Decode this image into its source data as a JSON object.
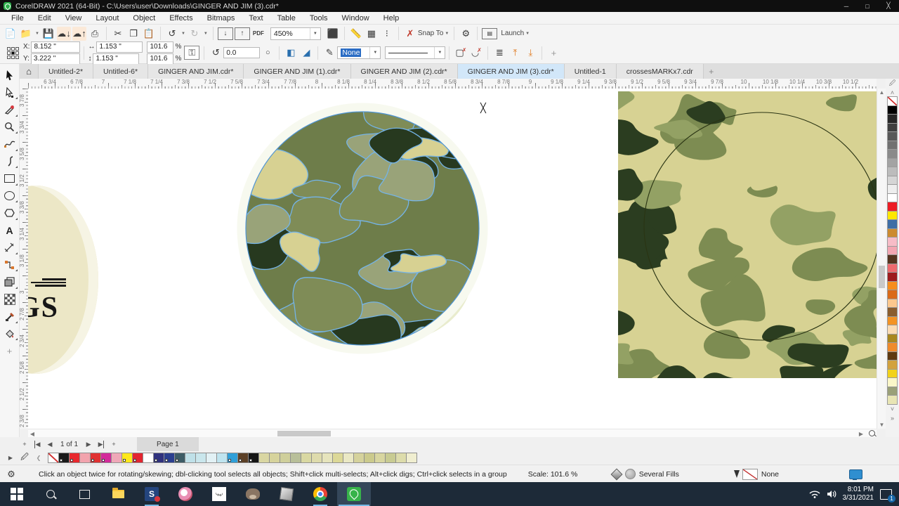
{
  "window": {
    "title": "CorelDRAW 2021 (64-Bit) - C:\\Users\\user\\Downloads\\GINGER AND JIM (3).cdr*"
  },
  "menu_bar": {
    "items": [
      "File",
      "Edit",
      "View",
      "Layout",
      "Object",
      "Effects",
      "Bitmaps",
      "Text",
      "Table",
      "Tools",
      "Window",
      "Help"
    ]
  },
  "toolbar": {
    "zoom_level": "450%",
    "pdf_label": "PDF",
    "snap_to_label": "Snap To",
    "launch_label": "Launch"
  },
  "property_bar": {
    "x_label": "X:",
    "y_label": "Y:",
    "x_value": "8.152 \"",
    "y_value": "3.222 \"",
    "width_value": "1.153 \"",
    "height_value": "1.153 \"",
    "scale_h": "101.6",
    "scale_v": "101.6",
    "percent": "%",
    "rotation_value": "0.0",
    "outline_width_value": "None"
  },
  "document_tabs": {
    "active_index": 5,
    "tabs": [
      "Untitled-2*",
      "Untitled-6*",
      "GINGER AND JIM.cdr*",
      "GINGER AND JIM (1).cdr*",
      "GINGER AND JIM (2).cdr*",
      "GINGER AND JIM (3).cdr*",
      "Untitled-1",
      "crossesMARKx7.cdr"
    ]
  },
  "rulers": {
    "horizontal_labels": [
      "6 3/4",
      "6 7/8",
      "7",
      "7 1/8",
      "7 1/4",
      "7 3/8",
      "7 1/2",
      "7 5/8",
      "7 3/4",
      "7 7/8",
      "8",
      "8 1/8",
      "8 1/4",
      "8 3/8",
      "8 1/2",
      "8 5/8",
      "8 3/4",
      "8 7/8",
      "9",
      "9 1/8",
      "9 1/4",
      "9 3/8",
      "9 1/2",
      "9 5/8",
      "9 3/4",
      "9 7/8",
      "10",
      "10 1/8",
      "10 1/4",
      "10 3/8",
      "10 1/2"
    ],
    "vertical_labels": [
      "3 7/8",
      "3 3/4",
      "3 5/8",
      "3 1/2",
      "3 3/8",
      "3 1/4",
      "3 1/8",
      "3",
      "2 7/8",
      "2 3/4",
      "2 5/8",
      "2 1/2",
      "2 3/8"
    ]
  },
  "toolbox": {
    "tools": [
      {
        "name": "pick-tool"
      },
      {
        "name": "shape-tool"
      },
      {
        "name": "crop-tool"
      },
      {
        "name": "zoom-tool"
      },
      {
        "name": "freehand-tool"
      },
      {
        "name": "pen-tool"
      },
      {
        "name": "rectangle-tool"
      },
      {
        "name": "ellipse-tool"
      },
      {
        "name": "polygon-tool"
      },
      {
        "name": "text-tool"
      },
      {
        "name": "dimension-tool"
      },
      {
        "name": "connector-tool"
      },
      {
        "name": "drop-shadow-tool"
      },
      {
        "name": "transparency-tool"
      },
      {
        "name": "eyedropper-tool"
      },
      {
        "name": "interactive-fill-tool"
      },
      {
        "name": "add-tool"
      }
    ]
  },
  "canvas": {
    "partial_object_text": "GS"
  },
  "camo": {
    "selection_outline": "#74b4e8",
    "circle": {
      "background": "#6e7d4a",
      "dark": "#27391f",
      "khaki": "#d7d192",
      "sage": "#99a379",
      "olive": "#7f8c57",
      "halo": "#e9ecce",
      "ring": "#f7f9ef",
      "crescent": "#b6bd97",
      "outline": "#4e94d4"
    },
    "rect": {
      "background": "#d7d293",
      "olive": "#7d8c52",
      "dark": "#2b3d20",
      "grass": "#93a164",
      "circle_outline": "#2a3413"
    }
  },
  "page_controls": {
    "page_indicator": "1 of 1",
    "page_tab_label": "Page 1"
  },
  "document_palette": {
    "colors": [
      {
        "c": "none"
      },
      {
        "c": "#1a1a1a",
        "m": 1
      },
      {
        "c": "#e8282d",
        "m": 1
      },
      {
        "c": "#f2a3ad"
      },
      {
        "c": "#e03131",
        "m": 1
      },
      {
        "c": "#d32a9a",
        "m": 1
      },
      {
        "c": "#efa8b8"
      },
      {
        "c": "#ffe81a",
        "m": 1
      },
      {
        "c": "#e32530",
        "m": 1
      },
      {
        "c": "#ffffff"
      },
      {
        "c": "#30327e",
        "m": 1
      },
      {
        "c": "#2b3f8f",
        "m": 1
      },
      {
        "c": "#3d5c66",
        "m": 1
      },
      {
        "c": "#bfe0e8"
      },
      {
        "c": "#c9e6ec"
      },
      {
        "c": "#e2f1f5"
      },
      {
        "c": "#bfe4ef"
      },
      {
        "c": "#2f9fd8",
        "m": 1
      },
      {
        "c": "#5c4026",
        "m": 1
      },
      {
        "c": "#151515",
        "m": 1
      },
      {
        "c": "#d9d6a2"
      },
      {
        "c": "#d6d39c"
      },
      {
        "c": "#cfcf9b"
      },
      {
        "c": "#b8bf99"
      },
      {
        "c": "#d9d8a2"
      },
      {
        "c": "#dedbac"
      },
      {
        "c": "#e6e4bc"
      },
      {
        "c": "#dcd897"
      },
      {
        "c": "#eae8c4"
      },
      {
        "c": "#d5d29c"
      },
      {
        "c": "#cbca8c"
      },
      {
        "c": "#d8d6a0"
      },
      {
        "c": "#c8cb92"
      },
      {
        "c": "#dddcab"
      },
      {
        "c": "#f0eed0"
      }
    ]
  },
  "color_palette": {
    "colors": [
      "none",
      "#000000",
      "#262626",
      "#3f3f3f",
      "#585858",
      "#717171",
      "#8a8a8a",
      "#a3a3a3",
      "#bcbcbc",
      "#d5d5d5",
      "#eeeeee",
      "#ffffff",
      "#ec1c24",
      "#ffe800",
      "#3e6ea5",
      "#cc8b2e",
      "#f7bcc7",
      "#f3a6b2",
      "#55341f",
      "#ee6a6e",
      "#9e1b1e",
      "#f68e1e",
      "#da6a18",
      "#fcc88e",
      "#8a5d2e",
      "#f39324",
      "#fbdcb4",
      "#a8871f",
      "#ef8b2c",
      "#5e3a10",
      "#d2a23e",
      "#f2d21a",
      "#fbf7c8",
      "#9aa078",
      "#e8e5b4"
    ]
  },
  "status_bar": {
    "hint": "Click an object twice for rotating/skewing; dbl-clicking tool selects all objects; Shift+click multi-selects; Alt+click digs; Ctrl+click selects in a group",
    "scale_label": "Scale: 101.6 %",
    "fill_status": "Several Fills",
    "outline_status": "None"
  },
  "taskbar": {
    "apps": [
      {
        "name": "start"
      },
      {
        "name": "search"
      },
      {
        "name": "task-view"
      },
      {
        "name": "file-explorer"
      },
      {
        "name": "paintshop",
        "running": true
      },
      {
        "name": "paint-app"
      },
      {
        "name": "pattern-app"
      },
      {
        "name": "gimp"
      },
      {
        "name": "cube-app"
      },
      {
        "name": "chrome",
        "running": true
      },
      {
        "name": "coreldraw",
        "running": true,
        "active": true
      }
    ],
    "time": "8:01 PM",
    "date": "3/31/2021",
    "notification_count": "1"
  }
}
